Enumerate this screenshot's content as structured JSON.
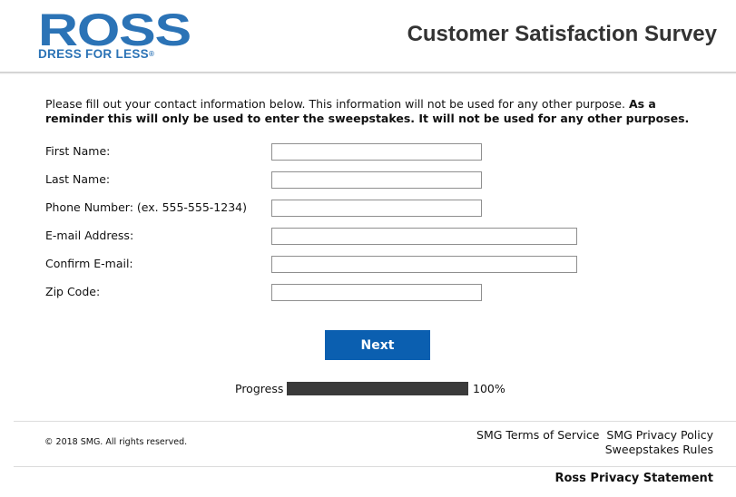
{
  "header": {
    "logo": {
      "brand": "ROSS",
      "tagline": "DRESS FOR LESS",
      "registered_mark": "®",
      "color": "#2b73b6"
    },
    "title": "Customer Satisfaction Survey"
  },
  "intro": {
    "text": "Please fill out your contact information below. This information will not be used for any other purpose. ",
    "bold_text": "As a reminder this will only be used to enter the sweepstakes. It will not be used for any other purposes."
  },
  "form": {
    "fields": [
      {
        "label": "First Name:",
        "value": "",
        "placeholder": ""
      },
      {
        "label": "Last Name:",
        "value": "",
        "placeholder": ""
      },
      {
        "label": "Phone Number: (ex. 555-555-1234)",
        "value": "",
        "placeholder": ""
      },
      {
        "label": "E-mail Address:",
        "value": "",
        "placeholder": ""
      },
      {
        "label": "Confirm E-mail:",
        "value": "",
        "placeholder": ""
      },
      {
        "label": "Zip Code:",
        "value": "",
        "placeholder": ""
      }
    ],
    "next_label": "Next",
    "button_color": "#0b5fb0"
  },
  "progress": {
    "label": "Progress",
    "value_text": "100%",
    "fraction": 1.0
  },
  "footer": {
    "copyright": "© 2018 SMG. All rights reserved.",
    "links": [
      "SMG Terms of Service",
      "SMG Privacy Policy",
      "Sweepstakes Rules"
    ],
    "privacy_statement": "Ross Privacy Statement"
  }
}
